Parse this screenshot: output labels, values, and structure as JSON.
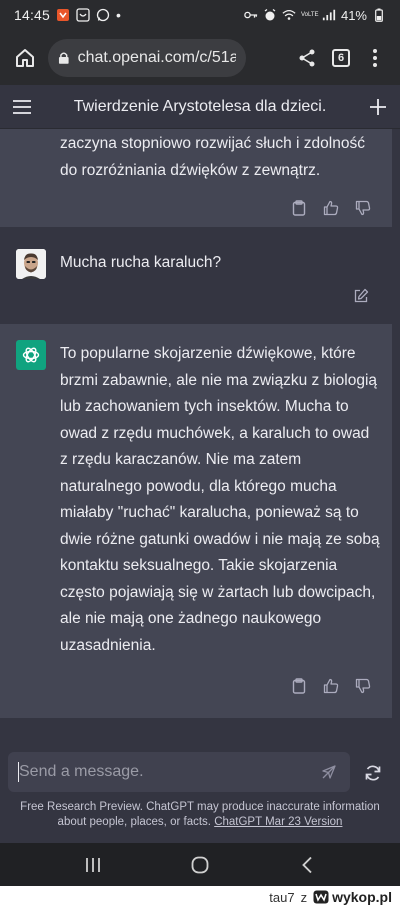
{
  "status_bar": {
    "time": "14:45",
    "dot": "•",
    "volte": "VoLTE",
    "battery": "41%",
    "icons": [
      "alert-app-icon",
      "notification-app-icon",
      "whatsapp-icon",
      "key-icon",
      "alarm-icon",
      "wifi-icon",
      "signal-icon",
      "battery-icon"
    ]
  },
  "browser": {
    "url": "chat.openai.com/c/51ał",
    "tab_count": "6"
  },
  "app": {
    "title": "Twierdzenie Arystotelesa dla dzieci."
  },
  "messages": [
    {
      "role": "assistant",
      "text": "zaczyna stopniowo rozwijać słuch i zdolność do rozróżniania dźwięków z zewnątrz."
    },
    {
      "role": "user",
      "text": "Mucha rucha karaluch?"
    },
    {
      "role": "assistant",
      "text": "To popularne skojarzenie dźwiękowe, które brzmi zabawnie, ale nie ma związku z biologią lub zachowaniem tych insektów. Mucha to owad z rzędu muchówek, a karaluch to owad z rzędu karaczanów. Nie ma zatem naturalnego powodu, dla którego mucha miałaby \"ruchać\" karalucha, ponieważ są to dwie różne gatunki owadów i nie mają ze sobą kontaktu seksualnego. Takie skojarzenia często pojawiają się w żartach lub dowcipach, ale nie mają one żadnego naukowego uzasadnienia."
    }
  ],
  "composer": {
    "placeholder": "Send a message."
  },
  "footer": {
    "note": "Free Research Preview. ChatGPT may produce inaccurate information about people, places, or facts.",
    "link": "ChatGPT Mar 23 Version"
  },
  "watermark": {
    "user": "tau7",
    "z": "z",
    "site": "wykop.pl"
  },
  "colors": {
    "assistant_bg": "#444654",
    "user_bg": "#343541",
    "accent": "#10a37f",
    "text": "#ececf1"
  }
}
